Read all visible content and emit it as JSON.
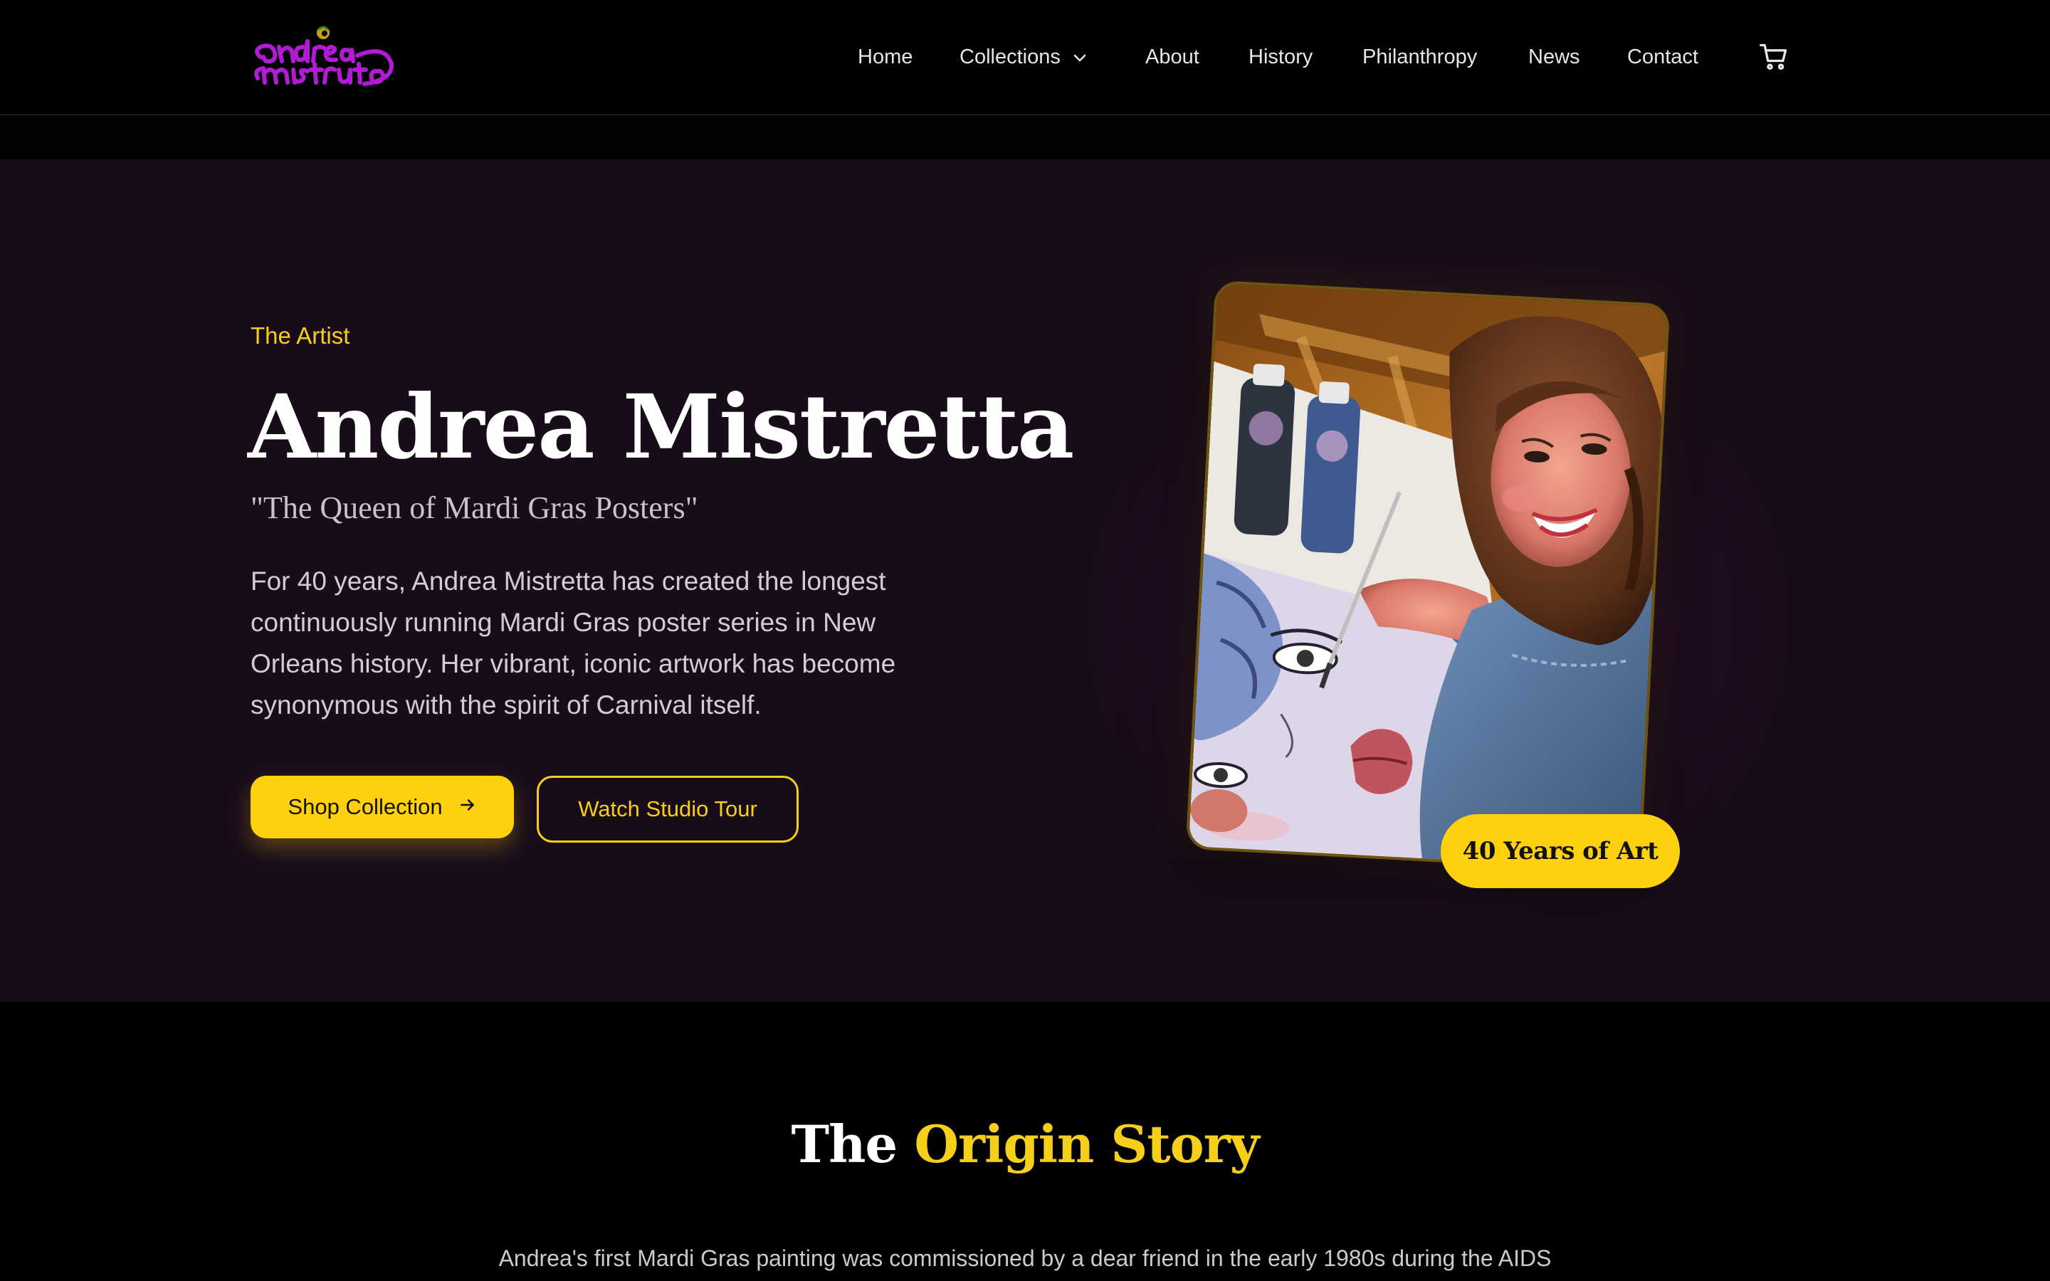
{
  "header": {
    "logo_text": "andrea mistretta",
    "nav": [
      {
        "label": "Home"
      },
      {
        "label": "Collections",
        "has_dropdown": true
      },
      {
        "label": "About"
      },
      {
        "label": "History"
      },
      {
        "label": "Philanthropy"
      },
      {
        "label": "News"
      },
      {
        "label": "Contact"
      }
    ],
    "cart_icon": "cart-icon"
  },
  "hero": {
    "eyebrow": "The Artist",
    "name": "Andrea Mistretta",
    "tagline": "\"The Queen of Mardi Gras Posters\"",
    "intro": "For 40 years, Andrea Mistretta has created the longest continuously running Mardi Gras poster series in New Orleans history. Her vibrant, iconic artwork has become synonymous with the spirit of Carnival itself.",
    "primary_button": "Shop Collection",
    "primary_button_icon": "arrow-right-icon",
    "secondary_button": "Watch Studio Tour",
    "badge": "40 Years of Art"
  },
  "origin": {
    "title_plain": "The ",
    "title_accent": "Origin Story",
    "text": "Andrea's first Mardi Gras painting was commissioned by a dear friend in the early 1980s during the AIDS"
  },
  "colors": {
    "accent_yellow": "#fdd10e",
    "hero_bg": "#190c1a",
    "logo_purple": "#b21bd6"
  }
}
